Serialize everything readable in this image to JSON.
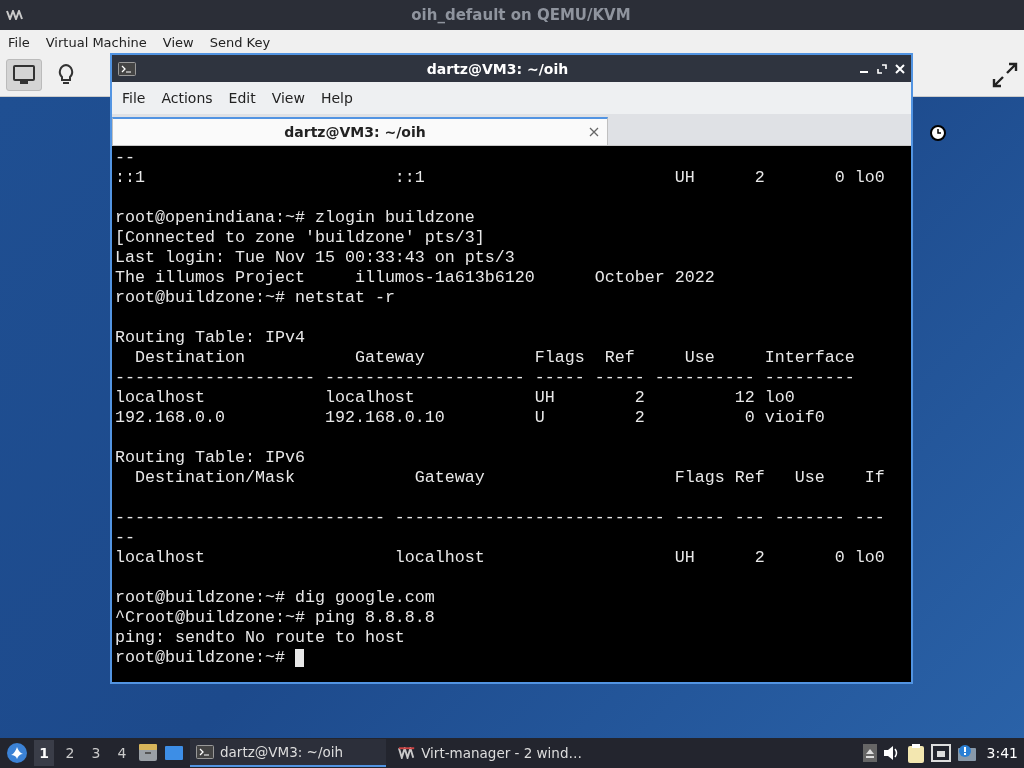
{
  "window": {
    "title": "oih_default on QEMU/KVM"
  },
  "menu": [
    "File",
    "Virtual Machine",
    "View",
    "Send Key"
  ],
  "toolbar": [
    {
      "kind": "console",
      "selected": true
    },
    {
      "kind": "details",
      "selected": false
    }
  ],
  "terminal": {
    "title": "dartz@VM3: ~/oih",
    "menu": [
      "File",
      "Actions",
      "Edit",
      "View",
      "Help"
    ],
    "tabs": [
      {
        "label": "dartz@VM3: ~/oih",
        "selected": true
      }
    ],
    "lines": [
      {
        "kind": "text",
        "text": "--"
      },
      {
        "kind": "text",
        "text": "::1                         ::1                         UH      2       0 lo0"
      },
      {
        "kind": "blank"
      },
      {
        "kind": "text",
        "text": "root@openindiana:~# zlogin buildzone"
      },
      {
        "kind": "text",
        "text": "[Connected to zone 'buildzone' pts/3]"
      },
      {
        "kind": "text",
        "text": "Last login: Tue Nov 15 00:33:43 on pts/3"
      },
      {
        "kind": "text",
        "text": "The illumos Project     illumos-1a613b6120      October 2022"
      },
      {
        "kind": "text",
        "text": "root@buildzone:~# netstat -r"
      },
      {
        "kind": "blank"
      },
      {
        "kind": "text",
        "text": "Routing Table: IPv4"
      },
      {
        "kind": "text",
        "text": "  Destination           Gateway           Flags  Ref     Use     Interface"
      },
      {
        "kind": "text",
        "text": "-------------------- -------------------- ----- ----- ---------- ---------"
      },
      {
        "kind": "text",
        "text": "localhost            localhost            UH        2         12 lo0"
      },
      {
        "kind": "text",
        "text": "192.168.0.0          192.168.0.10         U         2          0 vioif0"
      },
      {
        "kind": "blank"
      },
      {
        "kind": "text",
        "text": "Routing Table: IPv6"
      },
      {
        "kind": "text",
        "text": "  Destination/Mask            Gateway                   Flags Ref   Use    If"
      },
      {
        "kind": "blank"
      },
      {
        "kind": "text",
        "text": "--------------------------- --------------------------- ----- --- ------- ---"
      },
      {
        "kind": "text",
        "text": "--"
      },
      {
        "kind": "text",
        "text": "localhost                   localhost                   UH      2       0 lo0"
      },
      {
        "kind": "blank"
      },
      {
        "kind": "text",
        "text": "root@buildzone:~# dig google.com"
      },
      {
        "kind": "text",
        "text": "^Croot@buildzone:~# ping 8.8.8.8"
      },
      {
        "kind": "text",
        "text": "ping: sendto No route to host"
      },
      {
        "kind": "prompt",
        "text": "root@buildzone:~#"
      }
    ]
  },
  "taskbar": {
    "workspaces": [
      {
        "label": "1",
        "selected": true
      },
      {
        "label": "2",
        "selected": false
      },
      {
        "label": "3",
        "selected": false
      },
      {
        "label": "4",
        "selected": false
      }
    ],
    "tasks": [
      {
        "kind": "terminal",
        "label": "dartz@VM3: ~/oih",
        "selected": true
      },
      {
        "kind": "virt-manager",
        "label": "Virt-manager - 2 wind…",
        "selected": false
      }
    ],
    "clock": "3:41"
  }
}
